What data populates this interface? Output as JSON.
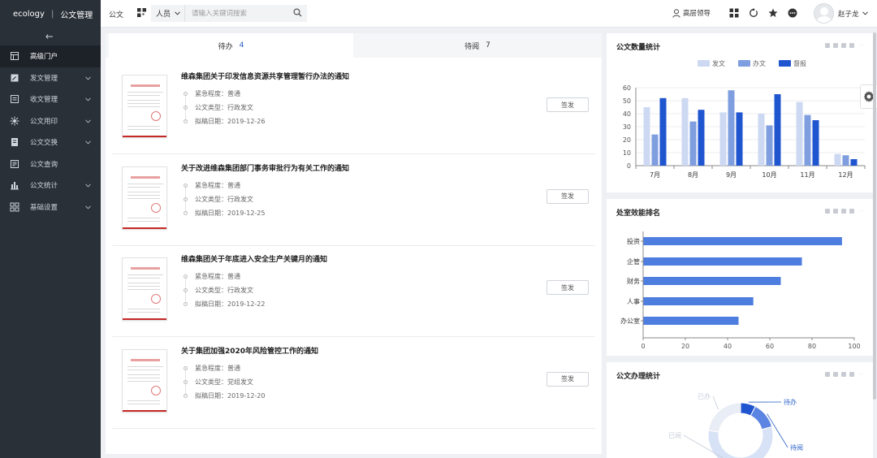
{
  "app": {
    "logo": "ecology",
    "module": "公文管理"
  },
  "sidebar": {
    "items": [
      {
        "label": "高级门户",
        "icon": "portal-icon",
        "chevron": false,
        "active": true
      },
      {
        "label": "发文管理",
        "icon": "edit-doc-icon",
        "chevron": true,
        "active": false
      },
      {
        "label": "收文管理",
        "icon": "inbox-doc-icon",
        "chevron": true,
        "active": false
      },
      {
        "label": "公文用印",
        "icon": "seal-icon",
        "chevron": true,
        "active": false
      },
      {
        "label": "公文交换",
        "icon": "exchange-icon",
        "chevron": true,
        "active": false
      },
      {
        "label": "公文查询",
        "icon": "query-icon",
        "chevron": false,
        "active": false
      },
      {
        "label": "公文统计",
        "icon": "bar-stat-icon",
        "chevron": true,
        "active": false
      },
      {
        "label": "基础设置",
        "icon": "grid-settings-icon",
        "chevron": true,
        "active": false
      }
    ]
  },
  "topbar": {
    "module": "公文",
    "select_value": "人员",
    "search_placeholder": "请输入关键词搜索",
    "leader_label": "高层领导",
    "user_name": "赵子龙"
  },
  "tabs": [
    {
      "label": "待办",
      "count": "4",
      "active": true
    },
    {
      "label": "待阅",
      "count": "7",
      "active": false
    }
  ],
  "items": [
    {
      "title": "维森集团关于印发信息资源共享管理暂行办法的通知",
      "urgency": "紧急程度：普通",
      "doc_type": "公文类型：行政发文",
      "date": "拟稿日期：2019-12-26",
      "action": "签发"
    },
    {
      "title": "关于改进维森集团部门事务审批行为有关工作的通知",
      "urgency": "紧急程度：普通",
      "doc_type": "公文类型：行政发文",
      "date": "拟稿日期：2019-12-25",
      "action": "签发"
    },
    {
      "title": "维森集团关于年底进入安全生产关键月的通知",
      "urgency": "紧急程度：普通",
      "doc_type": "公文类型：行政发文",
      "date": "拟稿日期：2019-12-22",
      "action": "签发"
    },
    {
      "title": "关于集团加强2020年风险管控工作的通知",
      "urgency": "紧急程度：普通",
      "doc_type": "公文类型：党组发文",
      "date": "拟稿日期：2019-12-20",
      "action": "签发"
    }
  ],
  "panels": {
    "stats_title": "公文数量统计",
    "rank_title": "处室效能排名",
    "handle_title": "公文办理统计"
  },
  "colors": {
    "accent": "#2860c8",
    "sidebar_bg": "#2a3038",
    "light_series": "#cdd9f2",
    "mid_series": "#7f9ee0",
    "dark_series": "#2055d0",
    "bar_blue": "#4d7ddf"
  },
  "chart_data": [
    {
      "type": "bar",
      "title": "公文数量统计",
      "categories": [
        "7月",
        "8月",
        "9月",
        "10月",
        "11月",
        "12月"
      ],
      "series": [
        {
          "name": "发文",
          "values": [
            45,
            52,
            41,
            40,
            49,
            9
          ]
        },
        {
          "name": "办文",
          "values": [
            24,
            34,
            58,
            31,
            39,
            8
          ]
        },
        {
          "name": "督报",
          "values": [
            52,
            43,
            41,
            55,
            35,
            5
          ]
        }
      ],
      "ylim": [
        0,
        60
      ],
      "yticks": [
        0,
        10,
        20,
        30,
        40,
        50,
        60
      ],
      "legend": "top-center",
      "grid": true
    },
    {
      "type": "bar",
      "orientation": "horizontal",
      "title": "处室效能排名",
      "categories": [
        "投资",
        "企管",
        "财务",
        "人事",
        "办公室"
      ],
      "values": [
        94,
        75,
        65,
        52,
        45
      ],
      "xlim": [
        0,
        100
      ],
      "xticks": [
        0,
        20,
        40,
        60,
        80,
        100
      ],
      "grid": false
    },
    {
      "type": "pie",
      "title": "公文办理统计",
      "categories": [
        "待办",
        "待阅",
        "已阅",
        "已办"
      ],
      "values": [
        4,
        7,
        30,
        12
      ],
      "note": "donut, partially visible"
    }
  ]
}
